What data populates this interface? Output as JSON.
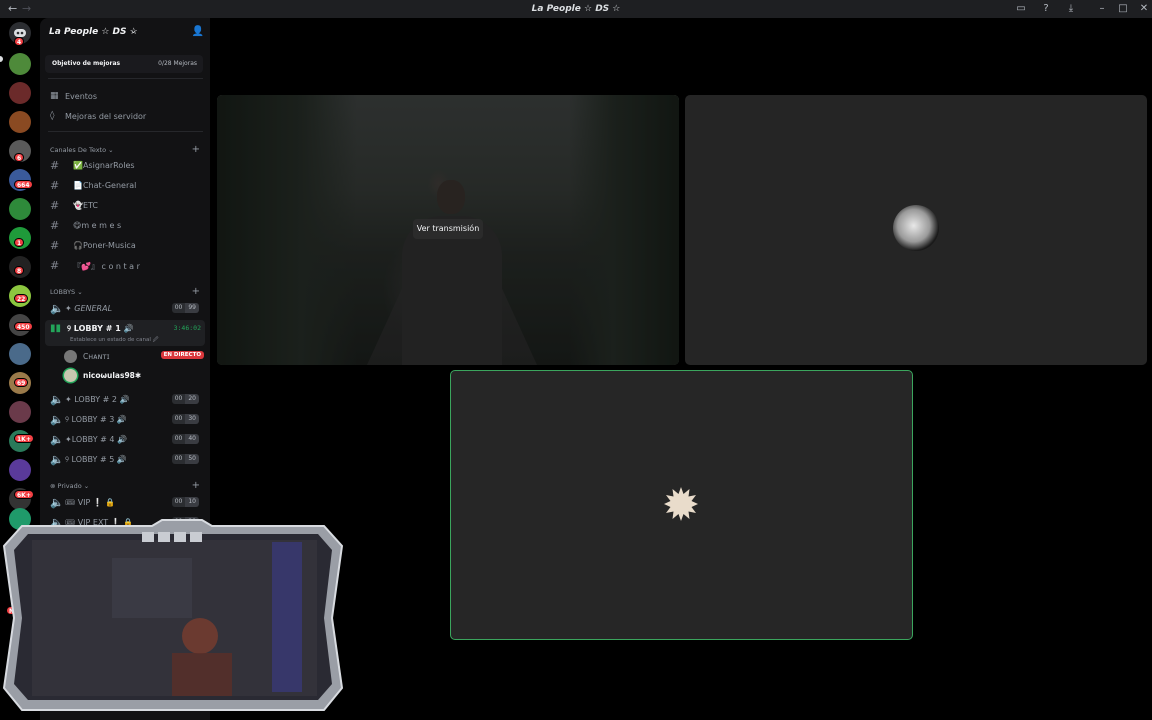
{
  "window": {
    "title": "La People ☆ DS ☆"
  },
  "rail": {
    "badges": [
      "4",
      "6",
      "664",
      "1",
      "8",
      "22",
      "450",
      "69",
      "1K+",
      "6K+",
      "NU"
    ]
  },
  "guild": {
    "name": "La People ☆ DS ☆",
    "boost_label": "Objetivo de mejoras",
    "boost_count": "0/28 Mejoras"
  },
  "nav": {
    "events": "Eventos",
    "boosts": "Mejoras del servidor"
  },
  "categories": {
    "text": "Canales De Texto",
    "lobbys": "LOBBYS",
    "private": "Privado"
  },
  "text_channels": [
    {
      "label": "✅AsignarRoles"
    },
    {
      "label": "📄Chat-General"
    },
    {
      "label": "👻ETC"
    },
    {
      "label": "😋m e m e s"
    },
    {
      "label": "🎧Poner-Musica"
    },
    {
      "label": "『💕』 c o n t a r"
    }
  ],
  "voice_channels": {
    "general": {
      "label": "✦ 𝘎𝘌𝘕𝘌𝘙𝘈𝘓",
      "count": "00",
      "limit": "99"
    },
    "lobby1": {
      "label": "୨ LOBBY # 1 🔊",
      "timer": "3:46:02",
      "status": "Establece un estado de canal 🖉"
    },
    "lobby2": {
      "label": "✦ LOBBY # 2 🔊",
      "count": "00",
      "limit": "20"
    },
    "lobby3": {
      "label": "୨ LOBBY # 3 🔊",
      "count": "00",
      "limit": "30"
    },
    "lobby4": {
      "label": "✦LOBBY # 4 🔊",
      "count": "00",
      "limit": "40"
    },
    "lobby5": {
      "label": "୨ LOBBY # 5 🔊",
      "count": "00",
      "limit": "50"
    },
    "vip": {
      "label": "🎟 VIP ❕ 🔒",
      "count": "00",
      "limit": "10"
    },
    "vipext": {
      "label": "🎟 VIP EXT ❕ 🔒",
      "count": "00",
      "limit": "20"
    }
  },
  "voice_users": [
    {
      "name": "Cʜᴀɴᴛɪ",
      "live": "EN DIRECTO"
    },
    {
      "name": "nicoωulas98✱"
    }
  ],
  "stage": {
    "watch_label": "Ver transmisión"
  },
  "colors": {
    "speaking": "#3ba55d",
    "live": "#da373c",
    "badge": "#f23f43"
  }
}
